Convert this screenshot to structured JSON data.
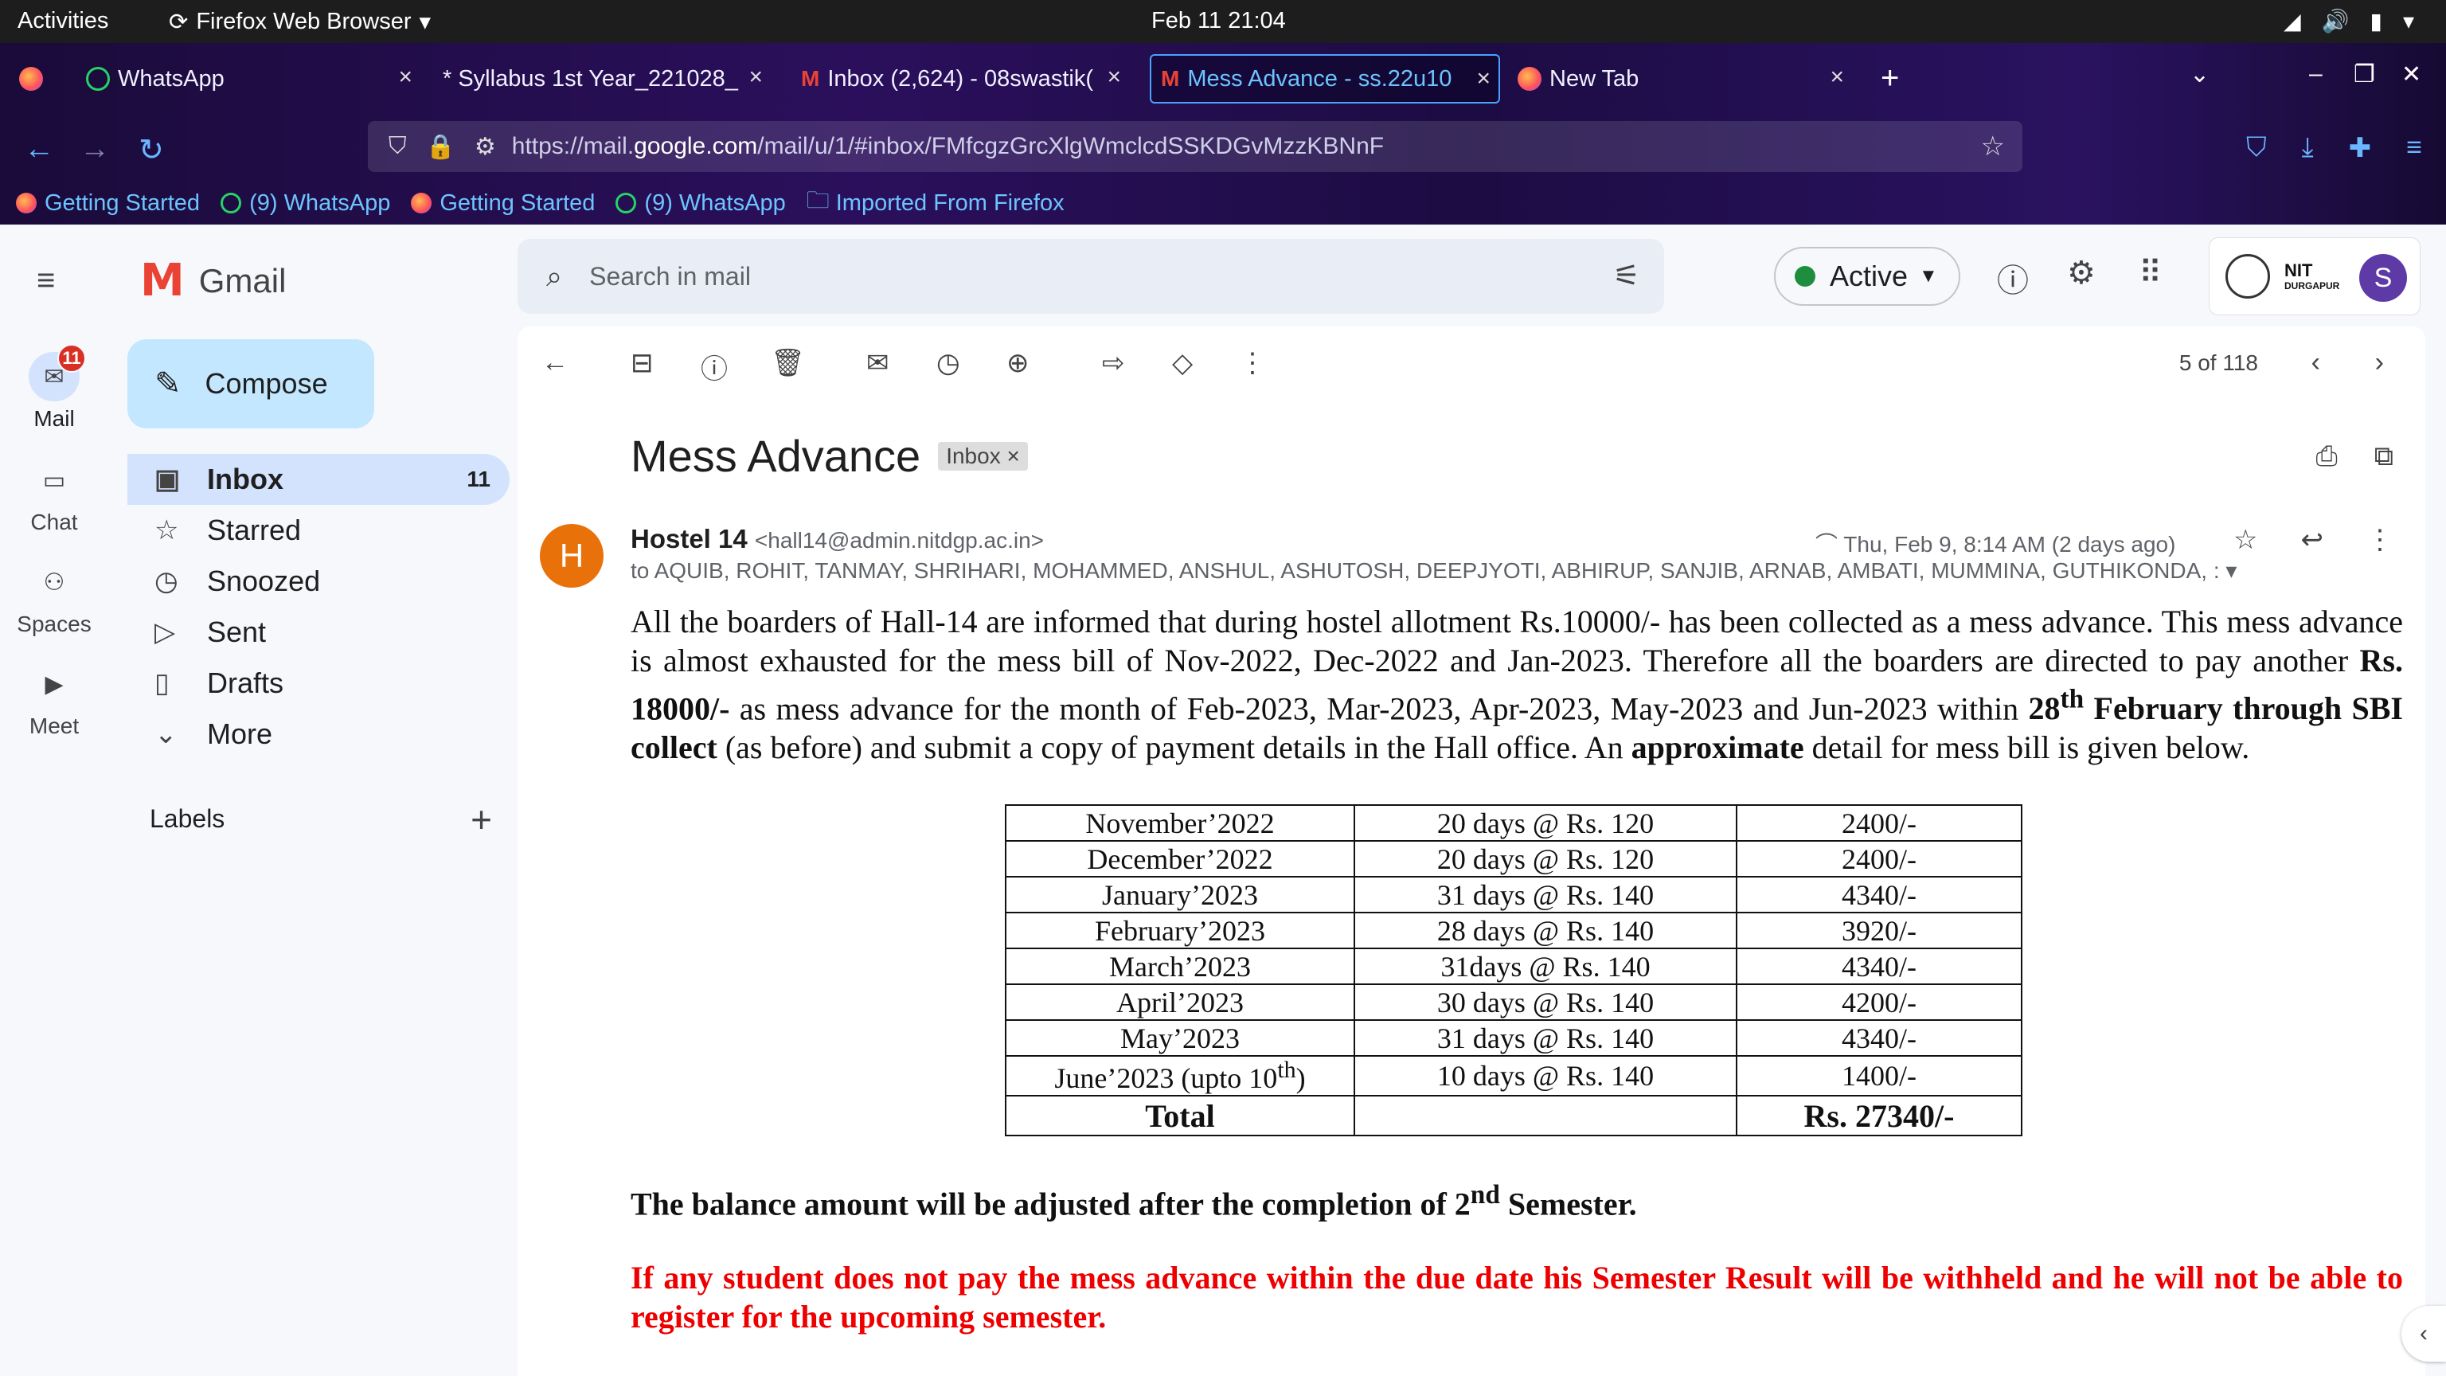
{
  "topbar": {
    "activities": "Activities",
    "app_name": "Firefox Web Browser",
    "clock": "Feb 11  21:04"
  },
  "tabs": [
    {
      "title": "WhatsApp",
      "icon": "whatsapp-icon"
    },
    {
      "title": "* Syllabus 1st Year_221028_",
      "icon": "none"
    },
    {
      "title": "Inbox (2,624) - 08swastik(",
      "icon": "gmail-icon"
    },
    {
      "title": "Mess Advance - ss.22u10",
      "icon": "gmail-icon",
      "active": true
    },
    {
      "title": "New Tab",
      "icon": "firefox-icon"
    }
  ],
  "urlbar": {
    "prefix": "https://mail.",
    "domain": "google.com",
    "path": "/mail/u/1/#inbox/FMfcgzGrcXlgWmclcdSSKDGvMzzKBNnF"
  },
  "bookmarks": [
    {
      "label": "Getting Started",
      "icon": "firefox-icon"
    },
    {
      "label": "(9) WhatsApp",
      "icon": "whatsapp-icon"
    },
    {
      "label": "Getting Started",
      "icon": "firefox-icon"
    },
    {
      "label": "(9) WhatsApp",
      "icon": "whatsapp-icon"
    },
    {
      "label": "Imported From Firefox",
      "icon": "folder-icon"
    }
  ],
  "rail": {
    "mail_label": "Mail",
    "mail_badge": "11",
    "chat_label": "Chat",
    "spaces_label": "Spaces",
    "meet_label": "Meet"
  },
  "gmail": {
    "logo_text": "Gmail",
    "search_placeholder": "Search in mail",
    "status": "Active",
    "account_org": "NIT",
    "account_org_sub": "DURGAPUR",
    "avatar_letter": "S"
  },
  "nav": {
    "compose": "Compose",
    "items": [
      {
        "label": "Inbox",
        "count": "11",
        "icon": "inbox-icon"
      },
      {
        "label": "Starred",
        "count": "",
        "icon": "star-icon"
      },
      {
        "label": "Snoozed",
        "count": "",
        "icon": "clock-icon"
      },
      {
        "label": "Sent",
        "count": "",
        "icon": "send-icon"
      },
      {
        "label": "Drafts",
        "count": "",
        "icon": "draft-icon"
      },
      {
        "label": "More",
        "count": "",
        "icon": "chevron-down-icon"
      }
    ],
    "labels_heading": "Labels"
  },
  "message": {
    "pager": "5 of 118",
    "subject": "Mess Advance",
    "label_chip": "Inbox",
    "sender_initial": "H",
    "sender_name": "Hostel 14",
    "sender_email": "<hall14@admin.nitdgp.ac.in>",
    "recipients": "to AQUIB, ROHIT, TANMAY, SHRIHARI, MOHAMMED, ANSHUL, ASHUTOSH, DEEPJYOTI, ABHIRUP, SANJIB, ARNAB, AMBATI, MUMMINA, GUTHIKONDA, :",
    "date": "Thu, Feb 9, 8:14 AM (2 days ago)",
    "body": {
      "p1_a": "All the boarders of Hall-14 are informed that during hostel allotment Rs.10000/- has been collected as a mess advance. This mess advance is almost exhausted for the mess bill of Nov-2022, Dec-2022 and Jan-2023. Therefore all the boarders are directed to pay another ",
      "p1_b": "Rs. 18000/-",
      "p1_c": " as mess advance for the month of Feb-2023, Mar-2023, Apr-2023, May-2023 and Jun-2023 within ",
      "p1_d": "28",
      "p1_d_sup": "th",
      "p1_e": " February through SBI collect",
      "p1_f": " (as before) and submit a copy of payment details in the Hall office. An ",
      "p1_g": "approximate",
      "p1_h": " detail for mess bill is given below."
    },
    "table": [
      {
        "month": "November’2022",
        "days": "20 days @ Rs. 120",
        "amount": "2400/-"
      },
      {
        "month": "December’2022",
        "days": "20 days @ Rs. 120",
        "amount": "2400/-"
      },
      {
        "month": "January’2023",
        "days": "31 days @ Rs. 140",
        "amount": "4340/-"
      },
      {
        "month": "February’2023",
        "days": "28 days @ Rs. 140",
        "amount": "3920/-"
      },
      {
        "month": "March’2023",
        "days": "31days @ Rs. 140",
        "amount": "4340/-"
      },
      {
        "month": "April’2023",
        "days": "30 days @ Rs. 140",
        "amount": "4200/-"
      },
      {
        "month": "May’2023",
        "days": "31 days @ Rs. 140",
        "amount": "4340/-"
      },
      {
        "month": "June’2023 (upto 10",
        "month_sup": "th",
        "month_tail": ")",
        "days": "10 days @ Rs. 140",
        "amount": "1400/-"
      }
    ],
    "total_label": "Total",
    "total_amount": "Rs. 27340/-",
    "note_a": "The balance amount will be adjusted after the completion of 2",
    "note_sup": "nd",
    "note_b": " Semester.",
    "warning": "If any student does not pay the mess advance within the due date his Semester Result will be withheld and he will not be able to register for the upcoming semester."
  }
}
